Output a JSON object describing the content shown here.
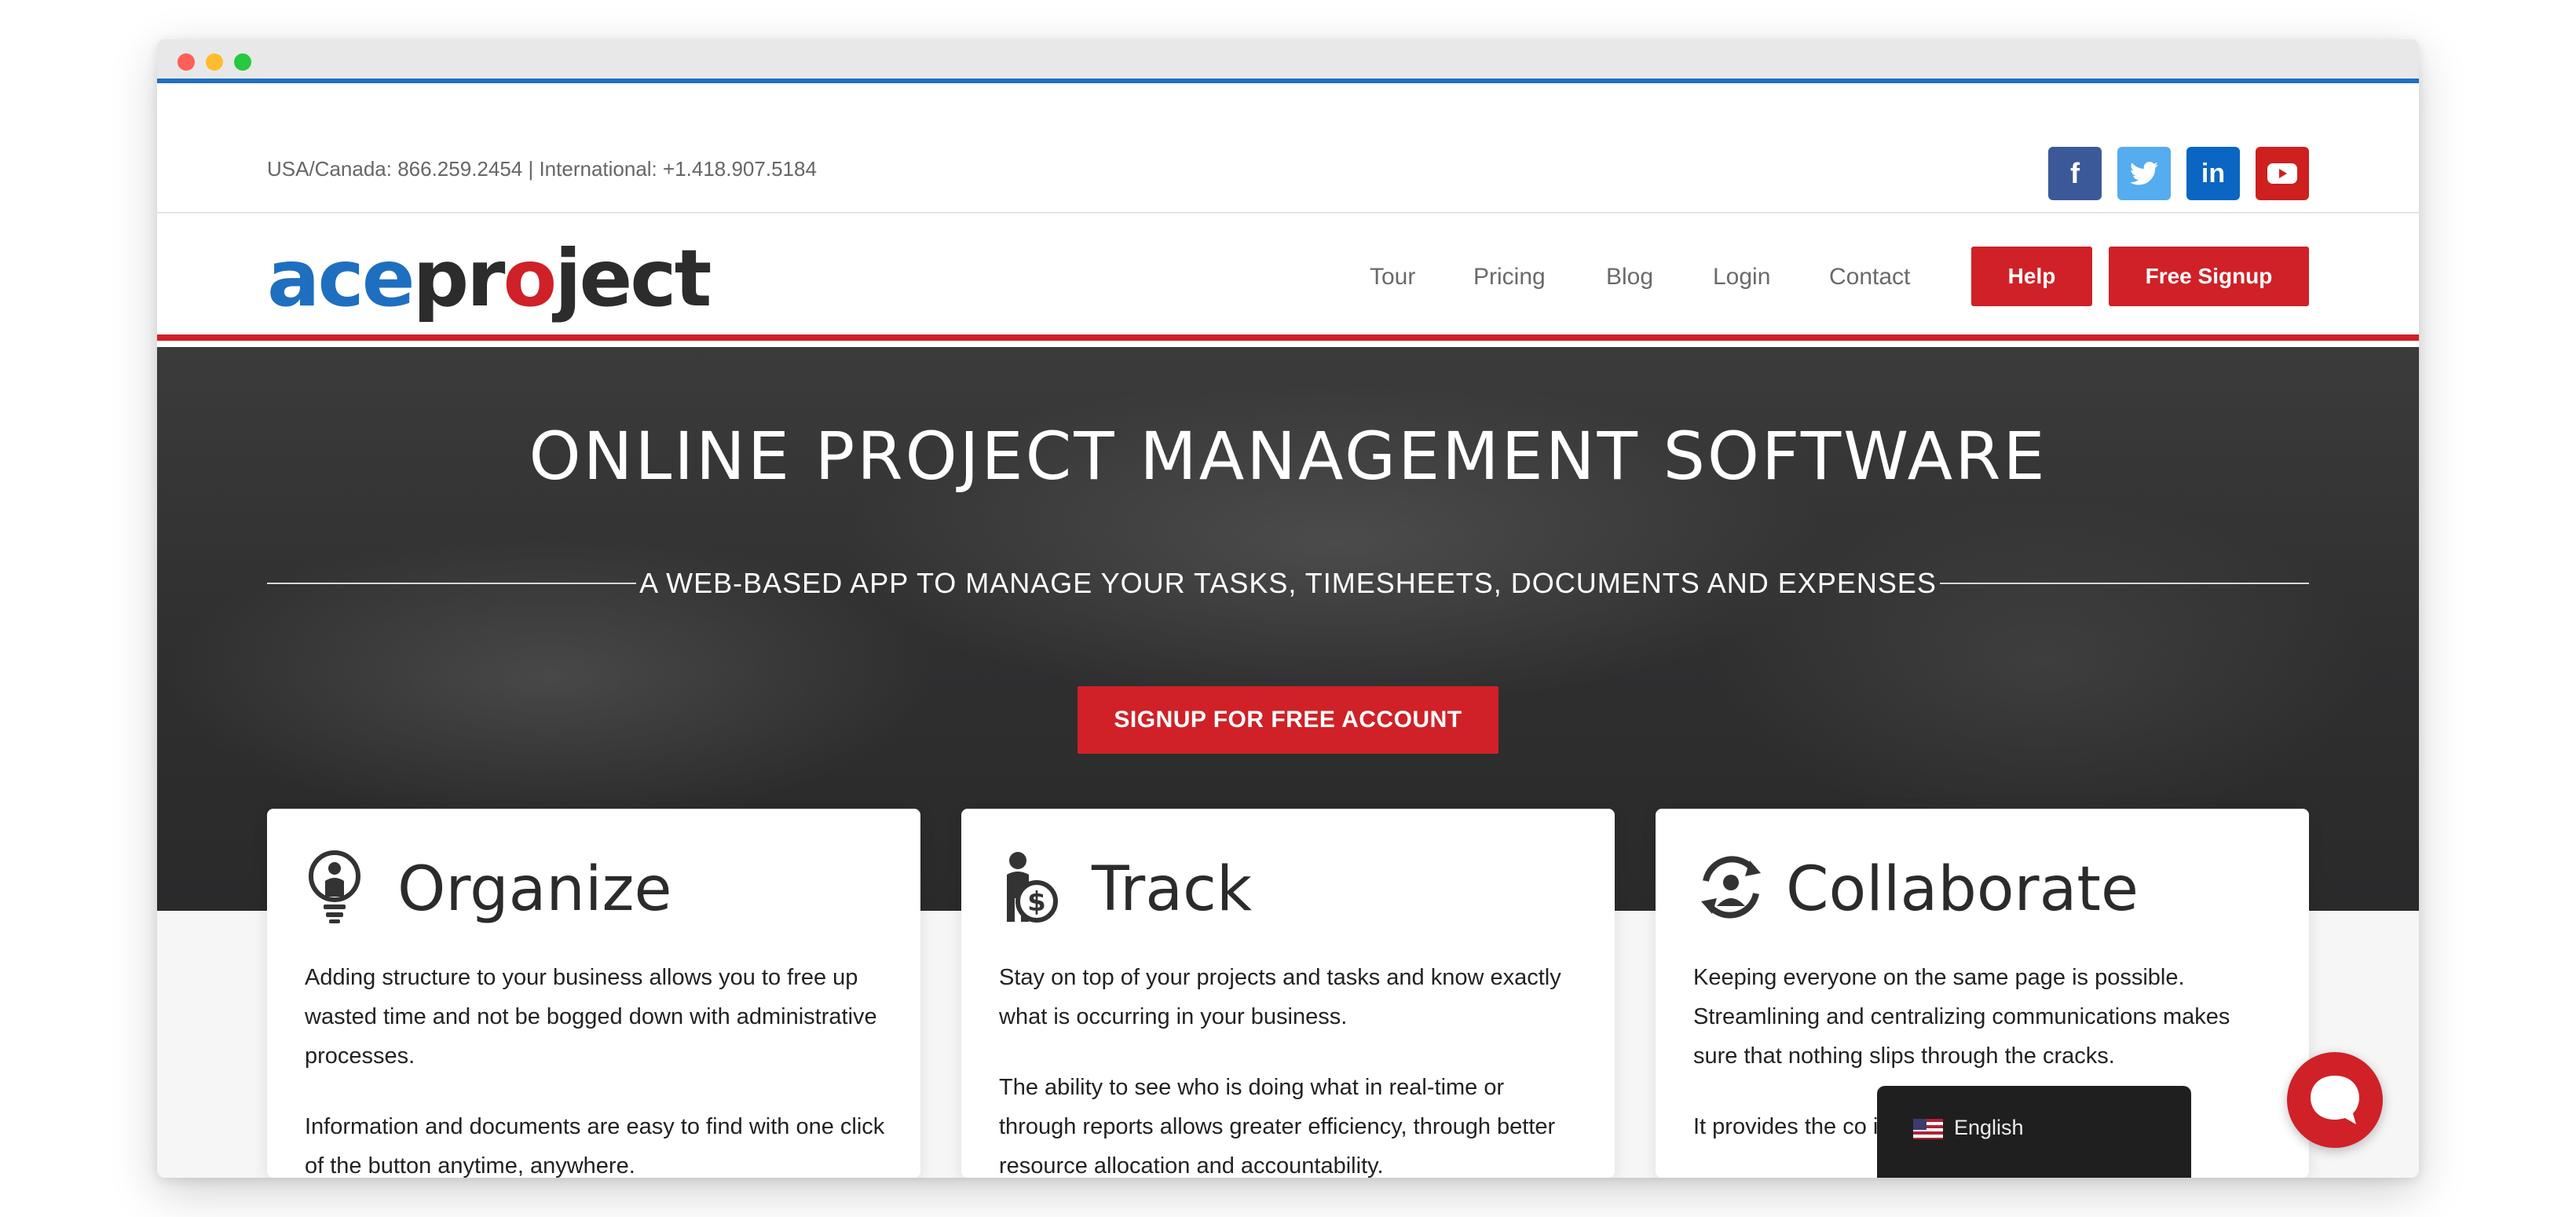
{
  "topbar": {
    "phone": "USA/Canada: 866.259.2454 | International: +1.418.907.5184",
    "social": [
      {
        "icon": "facebook-icon",
        "glyph": "f"
      },
      {
        "icon": "twitter-icon",
        "glyph": "t"
      },
      {
        "icon": "linkedin-icon",
        "glyph": "in"
      },
      {
        "icon": "youtube-icon",
        "glyph": "▶"
      }
    ]
  },
  "brand": {
    "logo_ace": "ace",
    "logo_pr": "pr",
    "logo_o": "o",
    "logo_ject": "ject",
    "colors": {
      "blue": "#1f6fc0",
      "red": "#cf2127",
      "dark": "#2c2c2c"
    }
  },
  "nav": {
    "links": [
      "Tour",
      "Pricing",
      "Blog",
      "Login",
      "Contact"
    ],
    "help": "Help",
    "signup": "Free Signup"
  },
  "hero": {
    "title": "ONLINE PROJECT MANAGEMENT SOFTWARE",
    "subtitle": "A WEB-BASED APP TO MANAGE YOUR TASKS, TIMESHEETS, DOCUMENTS AND EXPENSES",
    "cta": "SIGNUP FOR FREE ACCOUNT"
  },
  "features": [
    {
      "icon": "lightbulb-person-icon",
      "title": "Organize",
      "p1": "Adding structure to your business allows you to free up wasted time and not be bogged down with administrative processes.",
      "p2": "Information and documents are easy to find with one click of the button anytime, anywhere."
    },
    {
      "icon": "person-dollar-icon",
      "title": "Track",
      "p1": "Stay on top of your projects and tasks and know exactly what is occurring in your business.",
      "p2": "The ability to see who is doing what in real-time or through reports allows greater efficiency, through better resource allocation and accountability."
    },
    {
      "icon": "people-cycle-icon",
      "title": "Collaborate",
      "p1": "Keeping everyone on the same page is possible. Streamlining and centralizing communications makes sure that nothing slips through the cracks.",
      "p2": "It provides the co information or pro ailable."
    }
  ],
  "language": {
    "label": "English",
    "flag": "us-flag-icon"
  },
  "chat": {
    "icon": "chat-bubble-icon"
  }
}
